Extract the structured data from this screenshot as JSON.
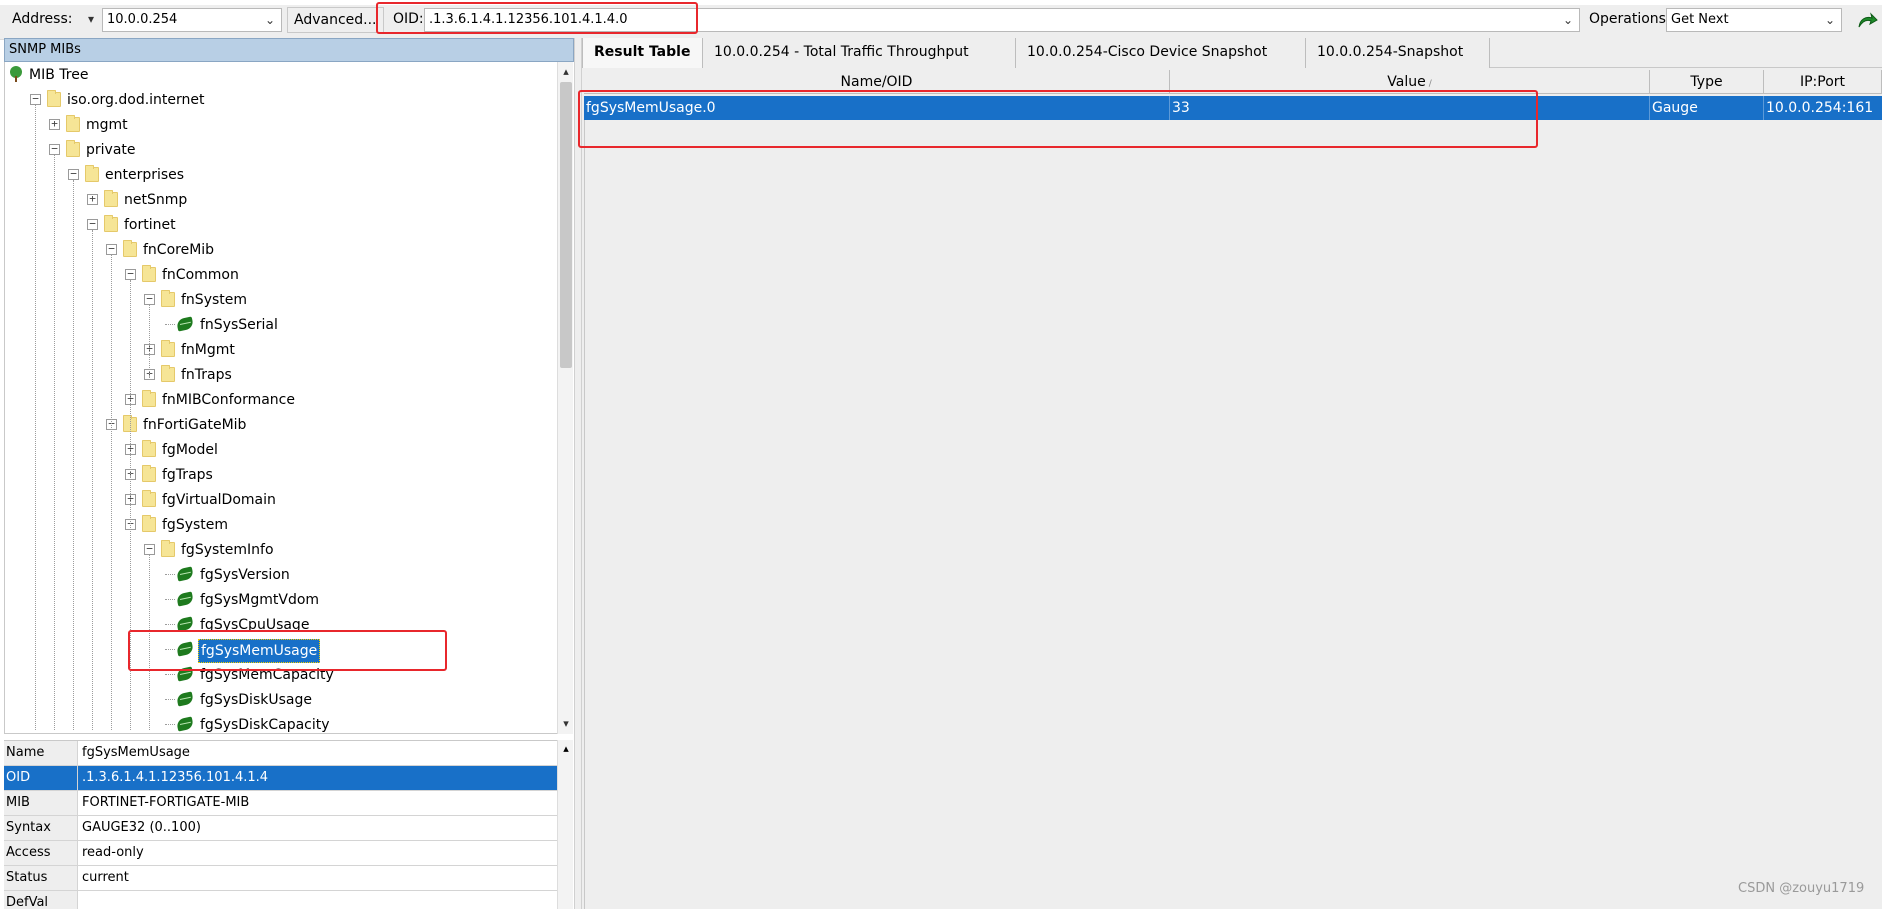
{
  "toolbar": {
    "address_label": "Address:",
    "address_value": "10.0.0.254",
    "advanced_label": "Advanced...",
    "oid_label": "OID:",
    "oid_value": ".1.3.6.1.4.1.12356.101.4.1.4.0",
    "operations_label": "Operations:",
    "operations_value": "Get Next"
  },
  "left_panel": {
    "title": "SNMP MIBs",
    "tree": [
      {
        "label": "MIB Tree",
        "level": 0,
        "kind": "root"
      },
      {
        "label": "iso.org.dod.internet",
        "level": 1,
        "kind": "folder",
        "expanded": true
      },
      {
        "label": "mgmt",
        "level": 2,
        "kind": "folder",
        "expanded": false
      },
      {
        "label": "private",
        "level": 2,
        "kind": "folder",
        "expanded": true
      },
      {
        "label": "enterprises",
        "level": 3,
        "kind": "folder",
        "expanded": true
      },
      {
        "label": "netSnmp",
        "level": 4,
        "kind": "folder",
        "expanded": false
      },
      {
        "label": "fortinet",
        "level": 4,
        "kind": "folder",
        "expanded": true
      },
      {
        "label": "fnCoreMib",
        "level": 5,
        "kind": "folder",
        "expanded": true
      },
      {
        "label": "fnCommon",
        "level": 6,
        "kind": "folder",
        "expanded": true
      },
      {
        "label": "fnSystem",
        "level": 7,
        "kind": "folder",
        "expanded": true
      },
      {
        "label": "fnSysSerial",
        "level": 8,
        "kind": "leaf"
      },
      {
        "label": "fnMgmt",
        "level": 7,
        "kind": "folder",
        "expanded": false
      },
      {
        "label": "fnTraps",
        "level": 7,
        "kind": "folder",
        "expanded": false
      },
      {
        "label": "fnMIBConformance",
        "level": 6,
        "kind": "folder",
        "expanded": false
      },
      {
        "label": "fnFortiGateMib",
        "level": 5,
        "kind": "folder",
        "expanded": true
      },
      {
        "label": "fgModel",
        "level": 6,
        "kind": "folder",
        "expanded": false
      },
      {
        "label": "fgTraps",
        "level": 6,
        "kind": "folder",
        "expanded": false
      },
      {
        "label": "fgVirtualDomain",
        "level": 6,
        "kind": "folder",
        "expanded": false
      },
      {
        "label": "fgSystem",
        "level": 6,
        "kind": "folder",
        "expanded": true
      },
      {
        "label": "fgSystemInfo",
        "level": 7,
        "kind": "folder",
        "expanded": true
      },
      {
        "label": "fgSysVersion",
        "level": 8,
        "kind": "leaf"
      },
      {
        "label": "fgSysMgmtVdom",
        "level": 8,
        "kind": "leaf"
      },
      {
        "label": "fgSysCpuUsage",
        "level": 8,
        "kind": "leaf"
      },
      {
        "label": "fgSysMemUsage",
        "level": 8,
        "kind": "leaf",
        "selected": true
      },
      {
        "label": "fgSysMemCapacity",
        "level": 8,
        "kind": "leaf"
      },
      {
        "label": "fgSysDiskUsage",
        "level": 8,
        "kind": "leaf"
      },
      {
        "label": "fgSysDiskCapacity",
        "level": 8,
        "kind": "leaf"
      }
    ],
    "properties": [
      {
        "key": "Name",
        "value": "fgSysMemUsage"
      },
      {
        "key": "OID",
        "value": ".1.3.6.1.4.1.12356.101.4.1.4",
        "selected": true
      },
      {
        "key": "MIB",
        "value": "FORTINET-FORTIGATE-MIB"
      },
      {
        "key": "Syntax",
        "value": "GAUGE32 (0..100)"
      },
      {
        "key": "Access",
        "value": "read-only"
      },
      {
        "key": "Status",
        "value": "current"
      },
      {
        "key": "DefVal",
        "value": ""
      }
    ]
  },
  "right_panel": {
    "tabs": [
      {
        "label": "Result Table",
        "active": true
      },
      {
        "label": "10.0.0.254 - Total Traffic Throughput"
      },
      {
        "label": "10.0.0.254-Cisco Device Snapshot"
      },
      {
        "label": "10.0.0.254-Snapshot"
      }
    ],
    "columns": [
      "Name/OID",
      "Value",
      "Type",
      "IP:Port"
    ],
    "rows": [
      {
        "name": "fgSysMemUsage.0",
        "value": "33",
        "type": "Gauge",
        "ip_port": "10.0.0.254:161"
      }
    ]
  },
  "watermark": "CSDN @zouyu1719",
  "colors": {
    "selection": "#1870c8",
    "highlight_box": "#e8272c",
    "panel_title": "#b8cfe5"
  }
}
